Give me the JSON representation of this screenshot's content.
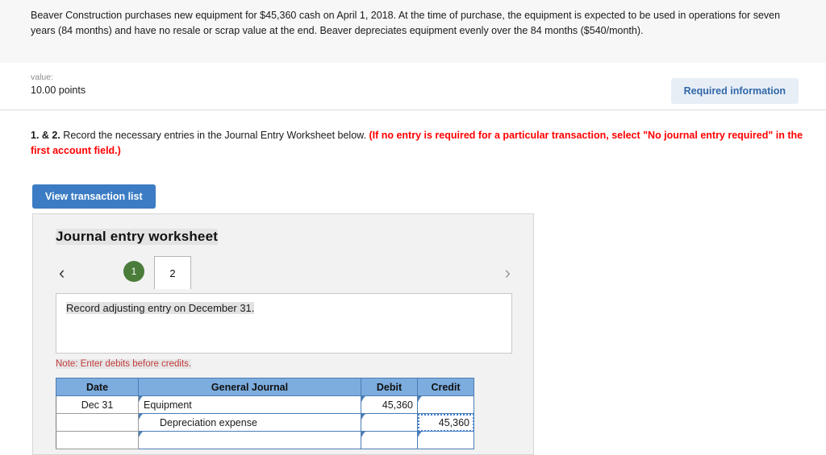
{
  "problem": {
    "text": "Beaver Construction purchases new equipment for $45,360 cash on April 1, 2018. At the time of purchase, the equipment is expected to be used in operations for seven years (84 months) and have no resale or scrap value at the end. Beaver depreciates equipment evenly over the 84 months ($540/month)."
  },
  "value_bar": {
    "label": "value:",
    "points": "10.00 points",
    "required_badge": "Required information"
  },
  "instructions": {
    "prefix": "1. & 2.",
    "body": " Record the necessary entries in the Journal Entry Worksheet below. ",
    "red": "(If no entry is required for a particular transaction, select \"No journal entry required\" in the first account field.)"
  },
  "toolbar": {
    "view_transaction_list": "View transaction list"
  },
  "worksheet": {
    "title": "Journal entry worksheet",
    "prev_icon": "chevron-left-icon",
    "next_icon": "chevron-right-icon",
    "tabs": [
      {
        "label": "1",
        "state": "completed"
      },
      {
        "label": "2",
        "state": "active"
      }
    ],
    "description": "Record adjusting entry on December 31.",
    "note": "Note: Enter debits before credits."
  },
  "journal_table": {
    "headers": [
      "Date",
      "General Journal",
      "Debit",
      "Credit"
    ],
    "rows": [
      {
        "date": "Dec 31",
        "account": "Equipment",
        "indent": false,
        "debit": "45,360",
        "credit": "",
        "credit_selected": false
      },
      {
        "date": "",
        "account": "Depreciation expense",
        "indent": true,
        "debit": "",
        "credit": "45,360",
        "credit_selected": true
      },
      {
        "date": "",
        "account": "",
        "indent": false,
        "debit": "",
        "credit": "",
        "credit_selected": false
      }
    ]
  },
  "colors": {
    "accent_blue": "#3b7cc4",
    "table_header_blue": "#7cadde",
    "table_border_blue": "#4a7db5",
    "tab_green": "#4a7c3a",
    "red_text": "#ff0000",
    "note_red": "#c23b3b",
    "badge_bg": "#e7eef6",
    "badge_text": "#3268a8",
    "panel_bg": "#f2f2f2"
  }
}
